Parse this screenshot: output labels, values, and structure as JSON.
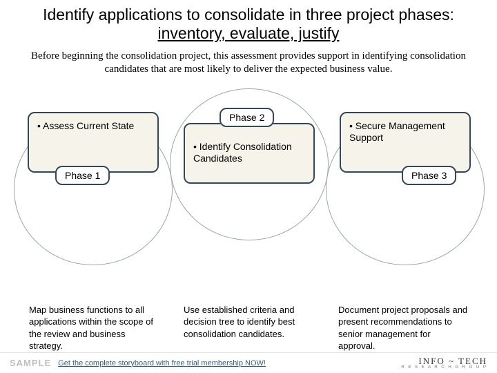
{
  "title_pre": "Identify applications to consolidate in three project phases: ",
  "title_underline": "inventory, evaluate, justify",
  "intro": "Before beginning the consolidation project, this assessment provides support in identifying consolidation candidates that are most likely to deliver the expected business value.",
  "phases": [
    {
      "tag": "Phase 1",
      "bullet": "Assess Current State",
      "desc": "Map business functions to all applications within the scope of the review and business strategy."
    },
    {
      "tag": "Phase 2",
      "bullet": "Identify Consolidation Candidates",
      "desc": "Use established criteria and decision tree to identify best consolidation candidates."
    },
    {
      "tag": "Phase 3",
      "bullet": "Secure Management Support",
      "desc": "Document project proposals and present recommendations to senior management for approval."
    }
  ],
  "footer": {
    "sample": "SAMPLE",
    "link": "Get the complete storyboard with free trial membership NOW!",
    "logo_brand": "INFO ~ TECH",
    "logo_sub": "R E S E A R C H   G R O U P"
  }
}
